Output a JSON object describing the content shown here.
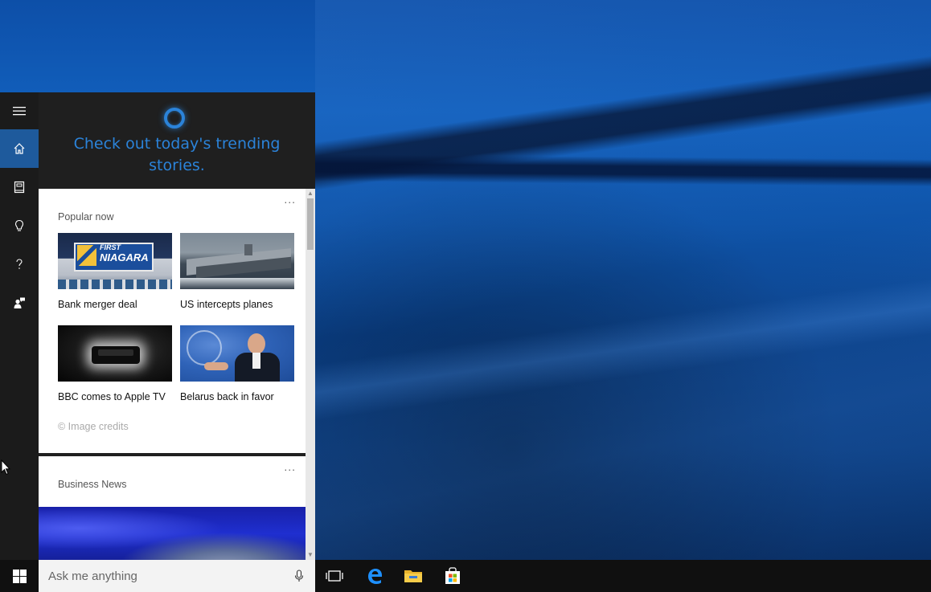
{
  "cortana": {
    "greeting": "Check out today's trending stories.",
    "rail": [
      {
        "name": "home"
      },
      {
        "name": "notebook"
      },
      {
        "name": "reminders"
      },
      {
        "name": "help"
      },
      {
        "name": "feedback"
      }
    ]
  },
  "popular": {
    "title": "Popular now",
    "more": "...",
    "items": [
      {
        "caption": "Bank merger deal",
        "image_text_top": "FIRST",
        "image_text_main": "NIAGARA"
      },
      {
        "caption": "US intercepts planes"
      },
      {
        "caption": "BBC comes to Apple TV"
      },
      {
        "caption": "Belarus back in favor"
      }
    ],
    "credits": "© Image credits"
  },
  "business": {
    "title": "Business News",
    "more": "..."
  },
  "search": {
    "placeholder": "Ask me anything"
  },
  "colors": {
    "accent": "#2b83d9",
    "rail_active": "#1e5a9c",
    "taskbar": "#101010"
  }
}
